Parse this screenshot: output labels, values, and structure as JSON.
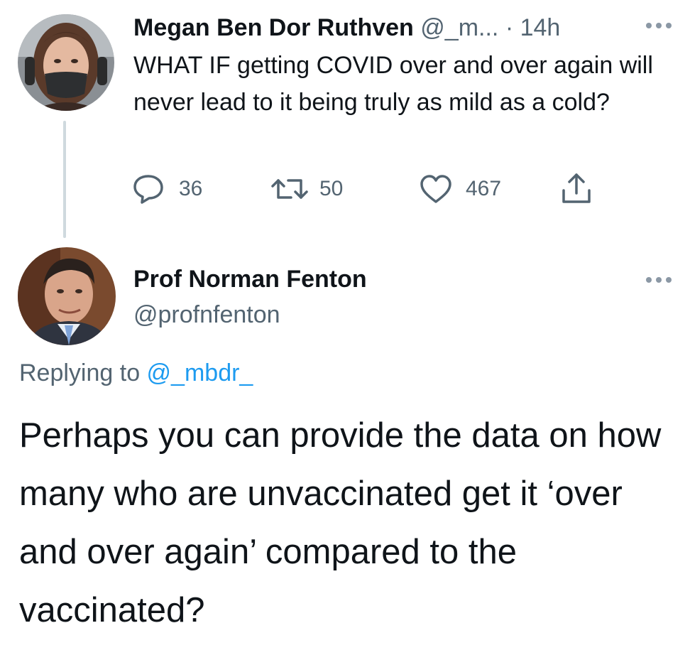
{
  "parent_tweet": {
    "author_name": "Megan Ben Dor Ruthven",
    "author_handle": "@_m...",
    "separator": "·",
    "time": "14h",
    "text": "WHAT IF getting COVID over and over again will never lead to it being truly as mild as a cold?",
    "more_icon": "ellipsis-icon",
    "actions": {
      "replies": "36",
      "retweets": "50",
      "likes": "467"
    }
  },
  "reply_tweet": {
    "author_name": "Prof Norman Fenton",
    "author_handle": "@profnfenton",
    "more_icon": "ellipsis-icon",
    "replying_prefix": "Replying to ",
    "replying_mention": "@_mbdr_",
    "text": "Perhaps you can provide the data on how many who are unvaccinated get it ‘over and over again’ compared to the vaccinated?"
  },
  "colors": {
    "text": "#0f1419",
    "muted": "#536471",
    "link": "#1d9bf0",
    "thread_line": "#cfd9de"
  }
}
